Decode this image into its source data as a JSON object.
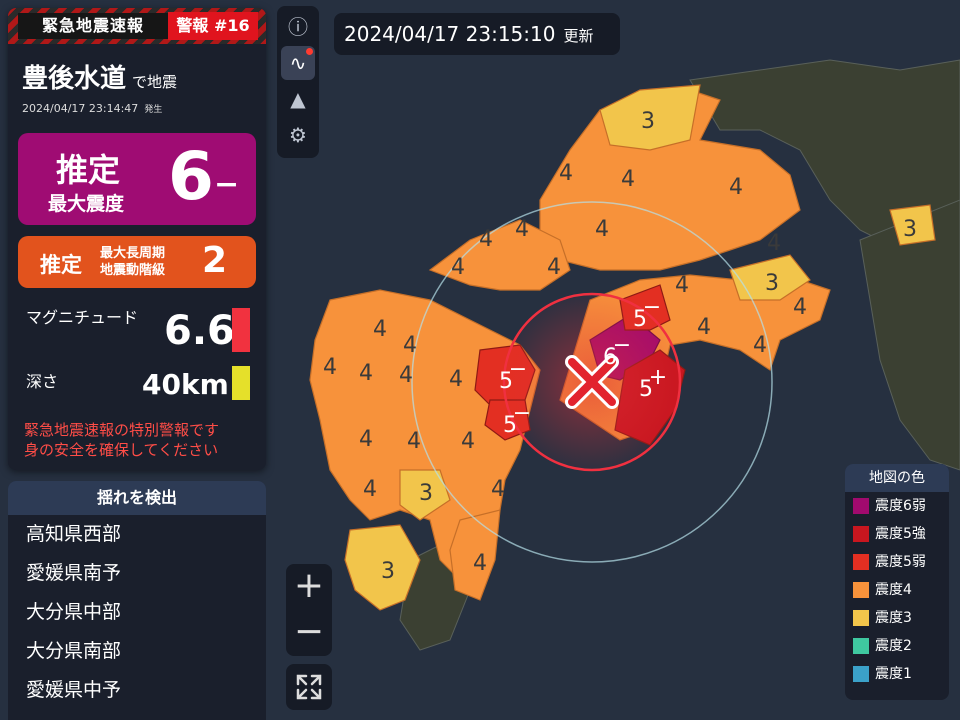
{
  "header": {
    "title": "緊急地震速報",
    "badge": "警報 #16"
  },
  "quake": {
    "place": "豊後水道",
    "place_suffix": "で地震",
    "occurred_time": "2024/04/17 23:14:47",
    "occurred_label": "発生",
    "max_intensity_label_1": "推定",
    "max_intensity_label_2": "最大震度",
    "max_intensity": "6",
    "max_intensity_mod": "−",
    "long_period_label_1": "推定",
    "long_period_label_2a": "最大長周期",
    "long_period_label_2b": "地震動階級",
    "long_period_class": "2",
    "magnitude_label": "マグニチュード",
    "magnitude": "6.6",
    "magnitude_color": "#f1323f",
    "depth_label": "深さ",
    "depth": "40km",
    "depth_color": "#e5e02a",
    "warning_line_1": "緊急地震速報の特別警報です",
    "warning_line_2": "身の安全を確保してください"
  },
  "detected": {
    "title": "揺れを検出",
    "items": [
      "高知県西部",
      "愛媛県南予",
      "大分県中部",
      "大分県南部",
      "愛媛県中予"
    ]
  },
  "toolbar": {
    "items": [
      {
        "icon": "info-icon",
        "glyph": "ⓘ"
      },
      {
        "icon": "waveform-icon",
        "glyph": "∿"
      },
      {
        "icon": "mountain-icon",
        "glyph": "▲"
      },
      {
        "icon": "gear-icon",
        "glyph": "⚙"
      }
    ]
  },
  "timebar": {
    "time": "2024/04/17 23:15:10",
    "label": "更新"
  },
  "zoom": {
    "plus": "+",
    "minus": "−"
  },
  "legend": {
    "title": "地図の色",
    "items": [
      {
        "label": "震度6弱",
        "color": "#a10a6e"
      },
      {
        "label": "震度5強",
        "color": "#c8161f"
      },
      {
        "label": "震度5弱",
        "color": "#e32f22"
      },
      {
        "label": "震度4",
        "color": "#f7923b"
      },
      {
        "label": "震度3",
        "color": "#f2c54b"
      },
      {
        "label": "震度2",
        "color": "#3fc8a0"
      },
      {
        "label": "震度1",
        "color": "#3ba1c9"
      }
    ]
  },
  "map": {
    "colors": {
      "sea": "#283040",
      "land": "#3a4030",
      "s4": "#f7923b",
      "s3": "#f2c54b",
      "s5m": "#e32f22",
      "s5p": "#c8161f",
      "s6m": "#a10a6e"
    },
    "labels": {
      "s3": "3",
      "s4": "4",
      "s5m": "5",
      "s5p": "5",
      "s6m": "6",
      "minus": "−",
      "plus": "+"
    }
  }
}
